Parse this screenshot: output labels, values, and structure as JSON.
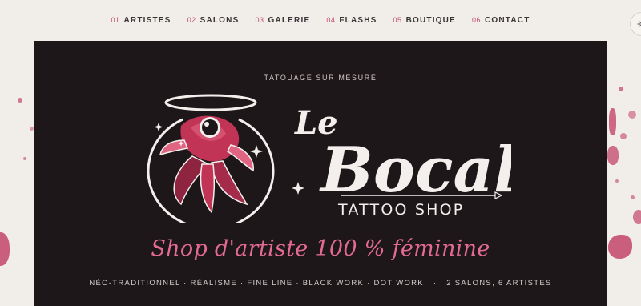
{
  "nav": {
    "items": [
      {
        "num": "01",
        "label": "ARTISTES"
      },
      {
        "num": "02",
        "label": "SALONS"
      },
      {
        "num": "03",
        "label": "GALERIE"
      },
      {
        "num": "04",
        "label": "FLASHS"
      },
      {
        "num": "05",
        "label": "BOUTIQUE"
      },
      {
        "num": "06",
        "label": "CONTACT"
      }
    ],
    "theme_icon": "sun-icon"
  },
  "hero": {
    "eyebrow": "TATOUAGE SUR MESURE",
    "logo": {
      "word_le": "Le",
      "word_bocal": "Bocal",
      "subtitle": "TATTOO SHOP",
      "icon": "goldfish-bowl-icon"
    },
    "tagline": "Shop d'artiste 100 % féminine",
    "styles_line": "NÉO-TRADITIONNEL · RÉALISME · FINE LINE · BLACK WORK · DOT WORK",
    "stats_line": "2 SALONS, 6 ARTISTES"
  },
  "colors": {
    "background": "#f1eee9",
    "hero_bg": "#1d1719",
    "accent": "#e36a94",
    "accent_dark": "#c0506e"
  }
}
